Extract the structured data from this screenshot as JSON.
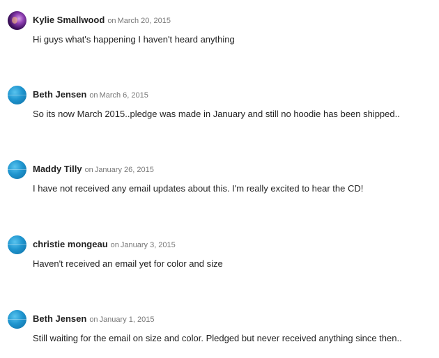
{
  "comments": [
    {
      "author": "Kylie Smallwood",
      "date_prefix": "on",
      "date": "March 20, 2015",
      "text": "Hi guys what's happening I haven't heard anything",
      "avatar": "user-photo-avatar"
    },
    {
      "author": "Beth Jensen",
      "date_prefix": "on",
      "date": "March 6, 2015",
      "text": "So its now March 2015..pledge was made in January and still no hoodie has been shipped..",
      "avatar": "default-avatar-icon"
    },
    {
      "author": "Maddy Tilly",
      "date_prefix": "on",
      "date": "January 26, 2015",
      "text": "I have not received any email updates about this. I'm really excited to hear the CD!",
      "avatar": "default-avatar-icon"
    },
    {
      "author": "christie mongeau",
      "date_prefix": "on",
      "date": "January 3, 2015",
      "text": "Haven't received an email yet for color and size",
      "avatar": "default-avatar-icon"
    },
    {
      "author": "Beth Jensen",
      "date_prefix": "on",
      "date": "January 1, 2015",
      "text": "Still waiting for the email on size and color. Pledged but never received anything since then..",
      "avatar": "default-avatar-icon"
    }
  ],
  "colors": {
    "author": "#222222",
    "date": "#777777",
    "avatar_default": "#1f95cf"
  }
}
